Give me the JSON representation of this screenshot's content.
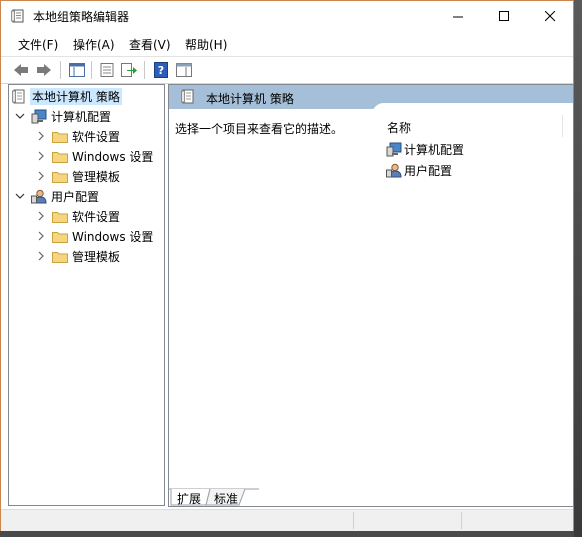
{
  "window": {
    "title": "本地组策略编辑器"
  },
  "menu": {
    "file": "文件(F)",
    "action": "操作(A)",
    "view": "查看(V)",
    "help": "帮助(H)"
  },
  "tree": {
    "root": "本地计算机 策略",
    "computer": "计算机配置",
    "user": "用户配置",
    "software": "软件设置",
    "windows": "Windows 设置",
    "admin": "管理模板"
  },
  "main": {
    "header": "本地计算机 策略",
    "description": "选择一个项目来查看它的描述。",
    "column_name": "名称",
    "items": [
      "计算机配置",
      "用户配置"
    ]
  },
  "tabs": {
    "extended": "扩展",
    "standard": "标准"
  },
  "colors": {
    "header_bg": "#a6bfd8",
    "selection": "#cce8ff",
    "folder": "#f5d67f",
    "window_border": "#c9864f"
  }
}
